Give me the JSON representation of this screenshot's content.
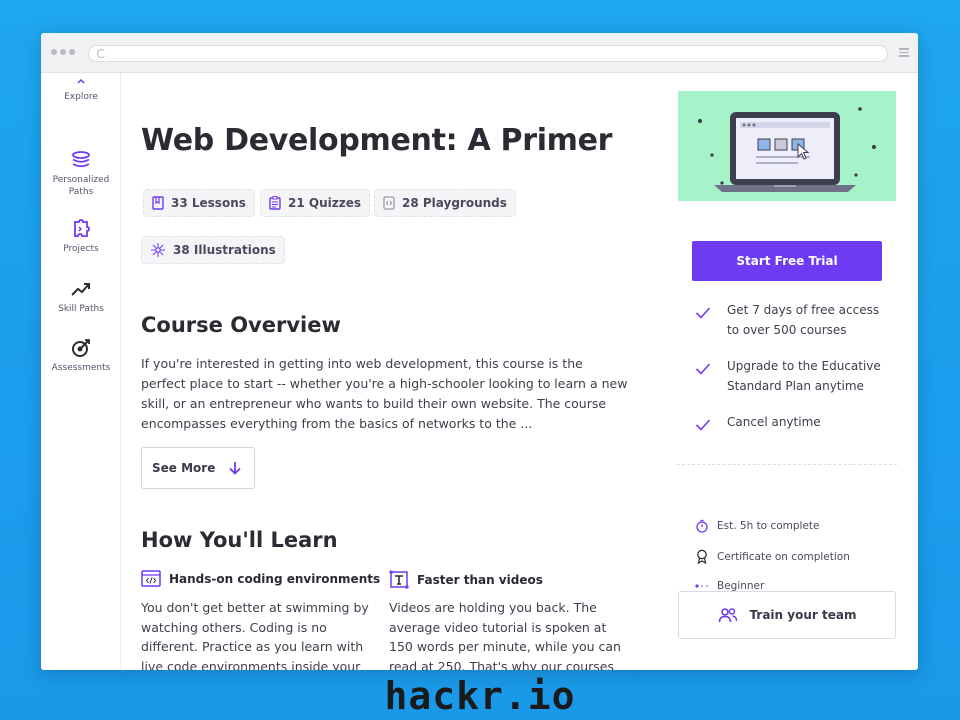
{
  "sidebar": {
    "items": [
      {
        "label": "Explore",
        "icon": "compass-icon"
      },
      {
        "label": "Personalized Paths",
        "icon": "layers-icon"
      },
      {
        "label": "Projects",
        "icon": "puzzle-icon"
      },
      {
        "label": "Skill Paths",
        "icon": "trend-icon"
      },
      {
        "label": "Assessments",
        "icon": "target-icon"
      }
    ]
  },
  "course": {
    "title": "Web Development: A Primer",
    "stats": {
      "lessons": "33 Lessons",
      "quizzes": "21 Quizzes",
      "playgrounds": "28 Playgrounds",
      "illustrations": "38 Illustrations"
    }
  },
  "overview": {
    "heading": "Course Overview",
    "text": "If you're interested in getting into web development, this course is the perfect place to start -- whether you're a high-schooler looking to learn a new skill, or an entrepreneur who wants to build their own website. The course encompasses everything from the basics of networks to the ...",
    "see_more": "See More"
  },
  "learn": {
    "heading": "How You'll Learn",
    "features": [
      {
        "title": "Hands-on coding environments",
        "text": "You don't get better at swimming by watching others. Coding is no different. Practice as you learn with live code environments inside your browser."
      },
      {
        "title": "Faster than videos",
        "text": "Videos are holding you back. The average video tutorial is spoken at 150 words per minute, while you can read at 250. That's why our courses are text-based."
      }
    ]
  },
  "sidebar_right": {
    "cta": "Start Free Trial",
    "benefits": [
      "Get 7 days of free access to over 500 courses",
      "Upgrade to the Educative Standard Plan anytime",
      "Cancel anytime"
    ],
    "meta": {
      "duration": "Est. 5h to complete",
      "certificate": "Certificate on completion",
      "level": "Beginner"
    },
    "team": "Train your team"
  },
  "watermark": "hackr.io",
  "colors": {
    "accent": "#6e3bf2",
    "hero_bg": "#a7f3c9",
    "background": "#1ea6ee"
  }
}
